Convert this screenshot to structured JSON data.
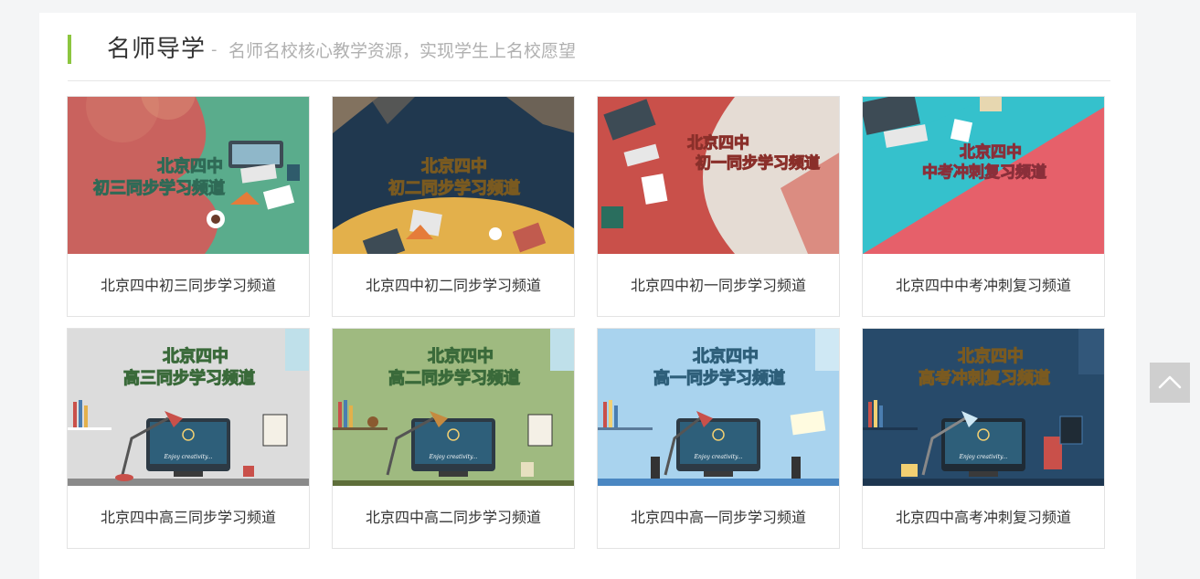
{
  "section": {
    "title": "名师导学",
    "dash": "-",
    "subtitle": "名师名校核心教学资源，实现学生上名校愿望",
    "accent_color": "#8cc63f"
  },
  "cards": [
    {
      "title": "北京四中初三同步学习频道",
      "banner_line1": "北京四中",
      "banner_line2": "初三同步学习频道"
    },
    {
      "title": "北京四中初二同步学习频道",
      "banner_line1": "北京四中",
      "banner_line2": "初二同步学习频道"
    },
    {
      "title": "北京四中初一同步学习频道",
      "banner_line1": "北京四中",
      "banner_line2": "初一同步学习频道"
    },
    {
      "title": "北京四中中考冲刺复习频道",
      "banner_line1": "北京四中",
      "banner_line2": "中考冲刺复习频道"
    },
    {
      "title": "北京四中高三同步学习频道",
      "banner_line1": "北京四中",
      "banner_line2": "高三同步学习频道",
      "screen_text": "Enjoy creativity..."
    },
    {
      "title": "北京四中高二同步学习频道",
      "banner_line1": "北京四中",
      "banner_line2": "高二同步学习频道",
      "screen_text": "Enjoy creativity..."
    },
    {
      "title": "北京四中高一同步学习频道",
      "banner_line1": "北京四中",
      "banner_line2": "高一同步学习频道",
      "screen_text": "Enjoy creativity..."
    },
    {
      "title": "北京四中高考冲刺复习频道",
      "banner_line1": "北京四中",
      "banner_line2": "高考冲刺复习频道",
      "screen_text": "Enjoy creativity..."
    }
  ],
  "back_to_top": {
    "icon": "chevron-up-icon"
  }
}
